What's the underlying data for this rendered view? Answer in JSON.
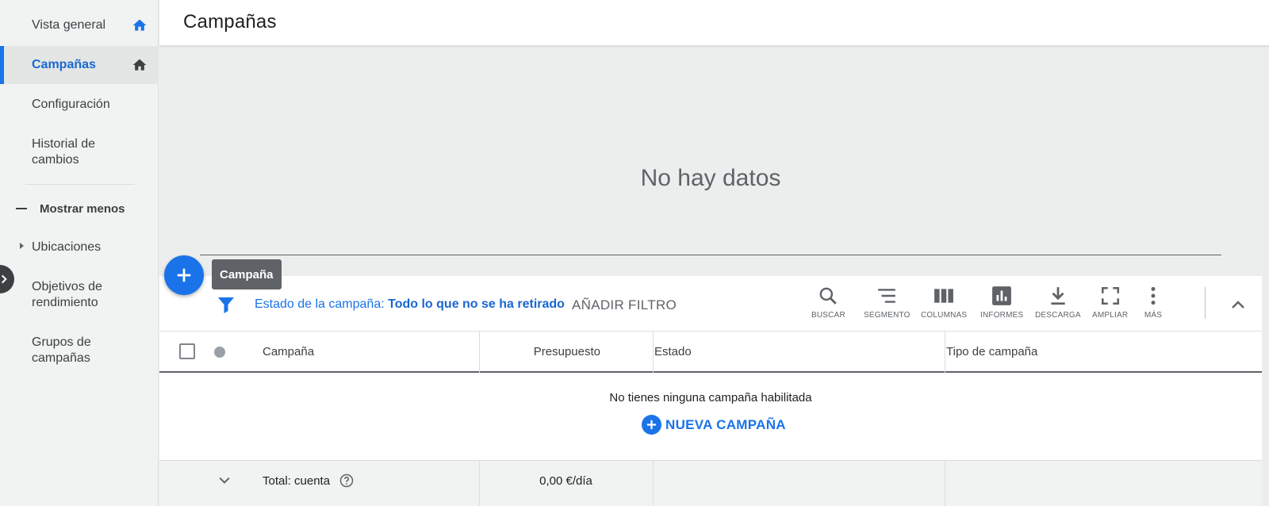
{
  "sidebar": {
    "items": [
      {
        "label": "Vista general"
      },
      {
        "label": "Campañas"
      },
      {
        "label": "Configuración"
      },
      {
        "label_line1": "Historial de",
        "label_line2": "cambios"
      }
    ],
    "show_less": "Mostrar menos",
    "more_items": [
      {
        "label": "Ubicaciones"
      },
      {
        "label_line1": "Objetivos de",
        "label_line2": "rendimiento"
      },
      {
        "label_line1": "Grupos de",
        "label_line2": "campañas"
      }
    ]
  },
  "header": {
    "title": "Campañas"
  },
  "chart": {
    "no_data": "No hay datos"
  },
  "fab": {
    "tooltip": "Campaña"
  },
  "filter": {
    "label": "Estado de la campaña:",
    "value": "Todo lo que no se ha retirado",
    "add_filter": "AÑADIR FILTRO"
  },
  "toolbar": {
    "search": "BUSCAR",
    "segment": "SEGMENTO",
    "columns": "COLUMNAS",
    "reports": "INFORMES",
    "download": "DESCARGA",
    "expand": "AMPLIAR",
    "more": "MÁS"
  },
  "table": {
    "headers": {
      "campaign": "Campaña",
      "budget": "Presupuesto",
      "status": "Estado",
      "type": "Tipo de campaña"
    },
    "empty_message": "No tienes ninguna campaña habilitada",
    "new_campaign": "NUEVA CAMPAÑA",
    "total": {
      "label": "Total: cuenta",
      "budget": "0,00 €/día"
    }
  },
  "colors": {
    "accent": "#1a73e8",
    "selected_bg": "#e3e6e5",
    "page_bg": "#eceeed"
  }
}
